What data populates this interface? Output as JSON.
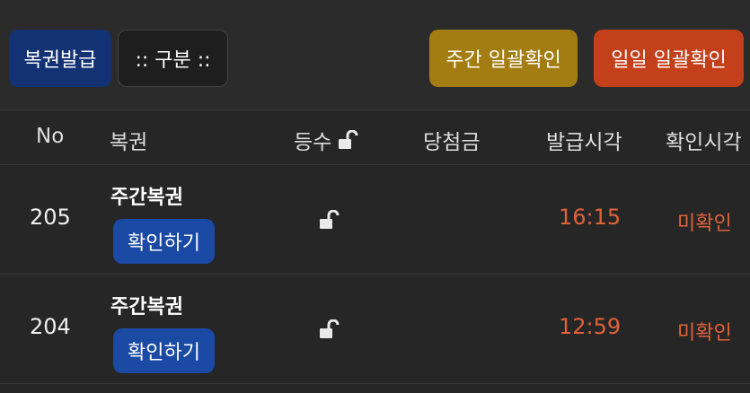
{
  "toolbar": {
    "issue_label": "복권발급",
    "category_label": ":: 구분 ::",
    "weekly_confirm_label": "주간 일괄확인",
    "daily_confirm_label": "일일 일괄확인"
  },
  "table": {
    "columns": {
      "no": "No",
      "ticket": "복권",
      "rank": "등수",
      "prize": "당첨금",
      "issued_time": "발급시각",
      "confirmed_time": "확인시각"
    },
    "rows": [
      {
        "no": "205",
        "ticket_name": "주간복권",
        "check_label": "확인하기",
        "issued_time": "16:15",
        "status": "미확인"
      },
      {
        "no": "204",
        "ticket_name": "주간복권",
        "check_label": "확인하기",
        "issued_time": "12:59",
        "status": "미확인"
      }
    ]
  },
  "icons": {
    "rank_header_icon": "unlock-icon",
    "row_rank_icon": "unlock-icon"
  },
  "colors": {
    "issue_button": "#133273",
    "weekly_button": "#a47d12",
    "daily_button": "#c4401b",
    "check_button": "#1a4aa4",
    "accent_text": "#e0623a"
  }
}
